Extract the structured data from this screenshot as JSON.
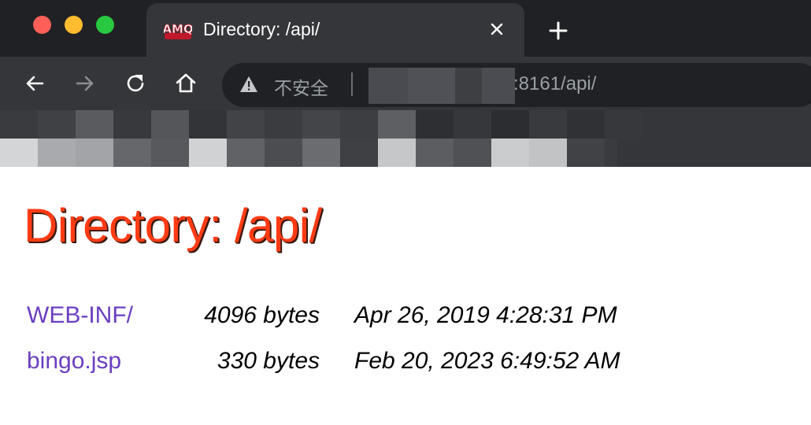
{
  "window": {
    "controls": [
      "close",
      "minimize",
      "zoom"
    ],
    "colors": {
      "close": "#fe5f57",
      "minimize": "#febc2e",
      "zoom": "#28c840"
    }
  },
  "tab": {
    "title": "Directory: /api/",
    "favicon": "amq-logo-icon",
    "favicon_text": "AMQ",
    "close_icon": "close-icon"
  },
  "new_tab": {
    "icon": "plus-icon"
  },
  "toolbar": {
    "back_icon": "back-arrow-icon",
    "forward_icon": "forward-arrow-icon",
    "reload_icon": "reload-icon",
    "home_icon": "home-icon"
  },
  "address_bar": {
    "security_icon": "warning-icon",
    "security_label": "不安全",
    "separator": "|",
    "url_visible": ":8161/api/"
  },
  "page": {
    "heading": "Directory: /api/",
    "heading_color": "#ff3b14",
    "link_color": "#6b3fc0",
    "entries": [
      {
        "name": "WEB-INF/",
        "size": "4096 bytes",
        "modified": "Apr 26, 2019 4:28:31 PM"
      },
      {
        "name": "bingo.jsp",
        "size": "330 bytes",
        "modified": "Feb 20, 2023 6:49:52 AM"
      }
    ]
  }
}
